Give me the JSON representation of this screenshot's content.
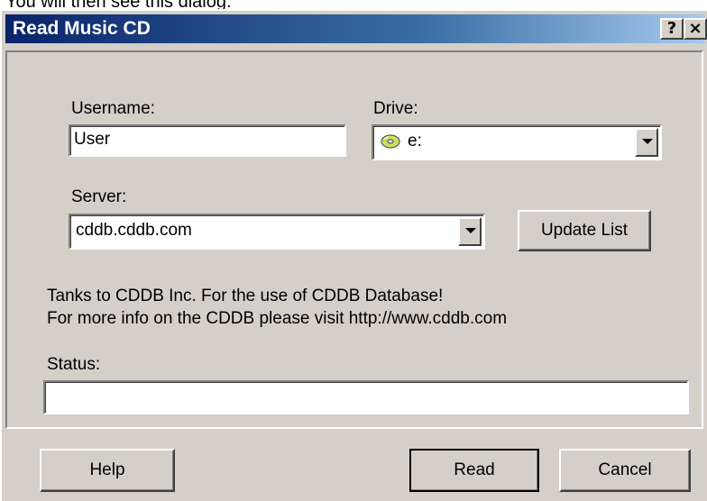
{
  "caption": "You will then see this dialog:",
  "window": {
    "title": "Read Music CD",
    "help_glyph": "?",
    "close_glyph": "×"
  },
  "form": {
    "username_label": "Username:",
    "username_value": "User",
    "drive_label": "Drive:",
    "drive_value": "e:",
    "drive_icon": "cd-drive-icon",
    "server_label": "Server:",
    "server_value": "cddb.cddb.com",
    "update_list_label": "Update List",
    "thanks_line1": "Tanks to CDDB Inc. For the use of CDDB Database!",
    "thanks_line2": "For more info on the CDDB please visit http://www.cddb.com",
    "status_label": "Status:",
    "status_value": ""
  },
  "buttons": {
    "help": "Help",
    "read": "Read",
    "cancel": "Cancel"
  },
  "colors": {
    "titlebar_start": "#0a246a",
    "titlebar_end": "#a6caf0",
    "dialog_face": "#d4d0c8"
  }
}
